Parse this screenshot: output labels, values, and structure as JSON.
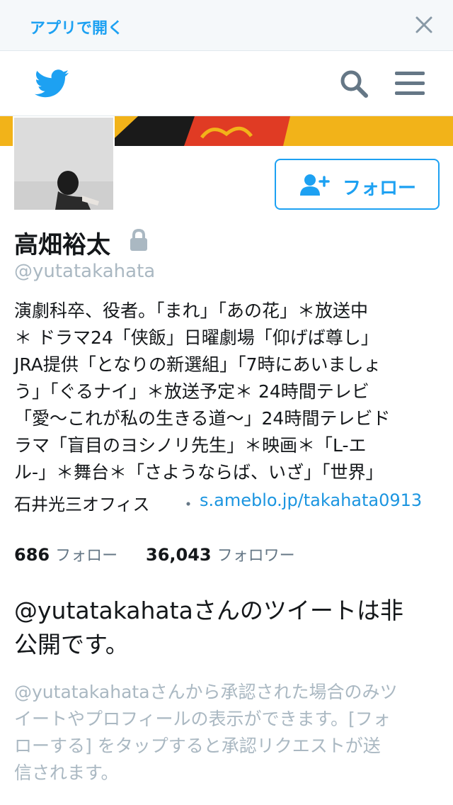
{
  "banner": {
    "open_app": "アプリで開く",
    "close_icon": "close-icon"
  },
  "topbar": {
    "logo_icon": "twitter-bird-icon",
    "search_icon": "search-icon",
    "menu_icon": "hamburger-menu-icon"
  },
  "profile": {
    "name": "高畑裕太",
    "lock_icon": "lock-icon",
    "handle": "@yutatakahata",
    "follow_label": "フォロー",
    "bio_lines": [
      "演劇科卒、役者。「まれ」「あの花」＊放送中",
      "＊ ドラマ24「侠飯」日曜劇場「仰げば尊し」",
      "JRA提供「となりの新選組」「7時にあいましょ",
      "う」「ぐるナイ」＊放送予定＊ 24時間テレビ",
      "「愛〜これが私の生きる道〜」24時間テレビド",
      "ラマ「盲目のヨシノリ先生」＊映画＊「L-エ",
      "ル-」＊舞台＊「さようならば、いざ」「世界」"
    ],
    "location": "石井光三オフィス",
    "separator": "・",
    "url": "s.ameblo.jp/takahata0913",
    "following_count": "686",
    "following_label": "フォロー",
    "followers_count": "36,043",
    "followers_label": "フォロワー"
  },
  "protected": {
    "title_line1": "@yutatakahataさんのツイートは非",
    "title_line2": "公開です。",
    "text_lines": [
      "@yutatakahataさんから承認された場合のみツ",
      "イートやプロフィールの表示ができます。[フォ",
      "ローする] をタップすると承認リクエストが送",
      "信されます。"
    ]
  },
  "colors": {
    "accent": "#1da1f2",
    "header_image": "#f2b319",
    "muted": "#aab8c2"
  }
}
